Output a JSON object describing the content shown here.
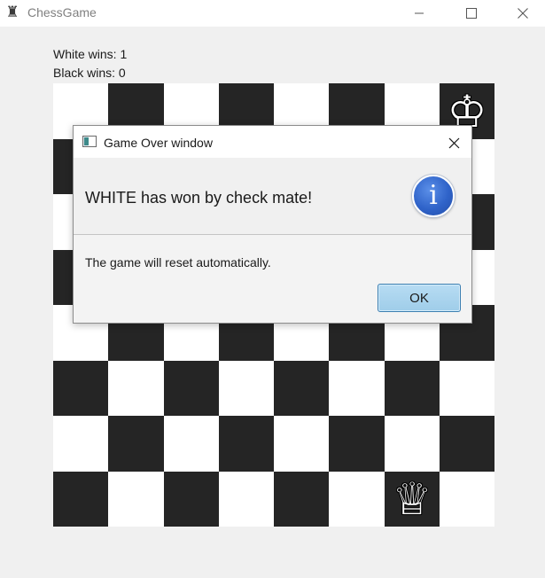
{
  "window": {
    "title": "ChessGame",
    "icon": "rook-icon",
    "controls": [
      "minimize-icon",
      "maximize-icon",
      "close-icon"
    ]
  },
  "scores": {
    "white_label": "White wins: 1",
    "black_label": "Black wins: 0"
  },
  "board": {
    "files": 8,
    "ranks": 8,
    "dark_color": "#252525",
    "light_color": "#ffffff",
    "pieces": [
      {
        "name": "white-king",
        "row": 0,
        "col": 7,
        "glyph": "♔"
      },
      {
        "name": "white-queen",
        "row": 7,
        "col": 6,
        "glyph": "♕"
      }
    ]
  },
  "dialog": {
    "title": "Game Over window",
    "headline": "WHITE has won by check mate!",
    "content": "The game will reset automatically.",
    "ok_label": "OK",
    "icon": "info-icon",
    "info_glyph": "i",
    "accent": "#2f63c9"
  }
}
